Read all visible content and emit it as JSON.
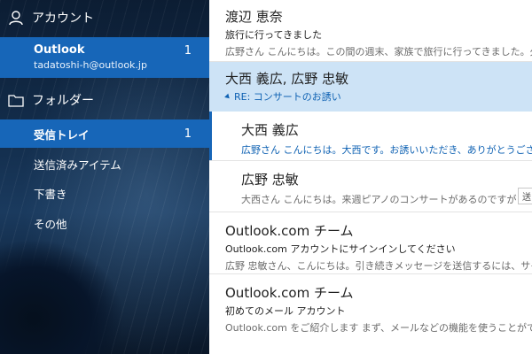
{
  "sidebar": {
    "account_header": "アカウント",
    "account": {
      "name": "Outlook",
      "email": "tadatoshi-h@outlook.jp",
      "count": "1"
    },
    "folder_header": "フォルダー",
    "folders": [
      {
        "label": "受信トレイ",
        "count": "1",
        "selected": true
      },
      {
        "label": "送信済みアイテム"
      },
      {
        "label": "下書き"
      },
      {
        "label": "その他"
      }
    ]
  },
  "messages": [
    {
      "from": "渡辺 恵奈",
      "subject": "旅行に行ってきました",
      "preview": "広野さん こんにちは。この間の週末、家族で旅行に行ってきました。久しぶりの"
    },
    {
      "from": "大西 義広, 広野 忠敏",
      "subject": "RE: コンサートのお誘い"
    },
    {
      "from": "大西 義広",
      "preview": "広野さん こんにちは。大西です。お誘いいただき、ありがとうございました。ちょ"
    },
    {
      "from": "広野 忠敏",
      "preview": "大西さん こんにちは。来週ピアノのコンサートがあるのですが ご一緒に",
      "chip": "送"
    },
    {
      "from": "Outlook.com チーム",
      "subject": "Outlook.com アカウントにサインインしてください",
      "preview": "広野 忠敏さん、こんにちは。引き続きメッセージを送信するには、サインインして"
    },
    {
      "from": "Outlook.com チーム",
      "subject": "初めてのメール アカウント",
      "preview": "Outlook.com をご紹介します まず、メールなどの機能を使うことができるよう、こ"
    }
  ],
  "colors": {
    "accent": "#1766b8",
    "selected_thread": "#cde3f6",
    "link_blue": "#0f62b3"
  }
}
